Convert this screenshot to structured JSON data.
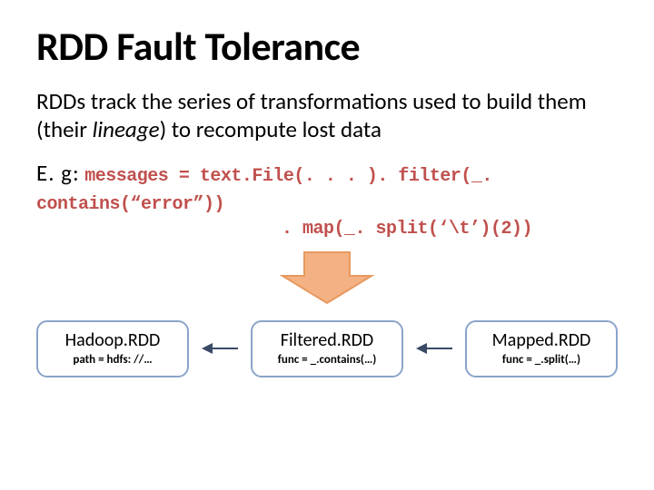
{
  "title": "RDD Fault Tolerance",
  "body": {
    "prefix": "RDDs track the series of transformations used to build them (their ",
    "lineage_word": "lineage",
    "suffix": ") to recompute lost data"
  },
  "example": {
    "prefix": "E. g:",
    "code_line1": "messages = text.File(. . . ). filter(_. contains(“error”))",
    "code_line2": ". map(_. split(‘\\t’)(2))"
  },
  "diagram": {
    "boxes": [
      {
        "title": "Hadoop.RDD",
        "sub": "path = hdfs: //…"
      },
      {
        "title": "Filtered.RDD",
        "sub": "func = _.contains(…)"
      },
      {
        "title": "Mapped.RDD",
        "sub": "func = _.split(…)"
      }
    ]
  },
  "colors": {
    "code": "#c0504d",
    "box_border": "#8ba4c9",
    "arrow_fill": "#f4b183",
    "arrow_stroke": "#e8995f",
    "chain_arrow": "#3a4a66"
  }
}
